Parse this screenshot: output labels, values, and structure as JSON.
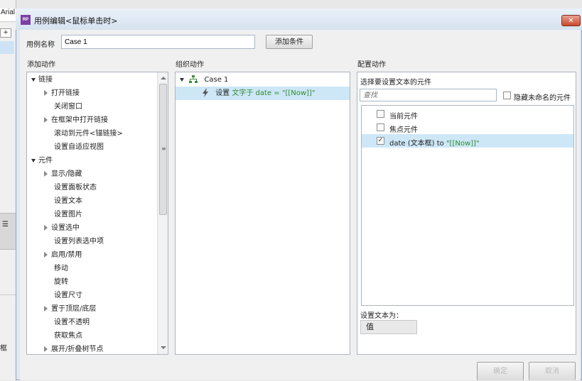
{
  "background_app": {
    "font_label": "Arial",
    "side_text": "框"
  },
  "dialog": {
    "title": "用例编辑<鼠标单击时>",
    "case_name_label": "用例名称",
    "case_name_value": "Case 1",
    "add_condition_label": "添加条件"
  },
  "add_action": {
    "header": "添加动作",
    "groups": [
      {
        "label": "链接",
        "items": [
          {
            "label": "打开链接",
            "expandable": true
          },
          {
            "label": "关闭窗口",
            "expandable": false
          },
          {
            "label": "在框架中打开链接",
            "expandable": true
          },
          {
            "label": "滚动到元件<锚链接>",
            "expandable": false
          },
          {
            "label": "设置自适应视图",
            "expandable": false
          }
        ]
      },
      {
        "label": "元件",
        "items": [
          {
            "label": "显示/隐藏",
            "expandable": true
          },
          {
            "label": "设置面板状态",
            "expandable": false
          },
          {
            "label": "设置文本",
            "expandable": false
          },
          {
            "label": "设置图片",
            "expandable": false
          },
          {
            "label": "设置选中",
            "expandable": true
          },
          {
            "label": "设置列表选中项",
            "expandable": false
          },
          {
            "label": "启用/禁用",
            "expandable": true
          },
          {
            "label": "移动",
            "expandable": false
          },
          {
            "label": "旋转",
            "expandable": false
          },
          {
            "label": "设置尺寸",
            "expandable": false
          },
          {
            "label": "置于顶层/底层",
            "expandable": true
          },
          {
            "label": "设置不透明",
            "expandable": false
          },
          {
            "label": "获取焦点",
            "expandable": false
          },
          {
            "label": "展开/折叠树节点",
            "expandable": true
          }
        ]
      }
    ]
  },
  "organize_action": {
    "header": "组织动作",
    "case_label": "Case 1",
    "action_prefix": "设置",
    "action_detail": "文字于 date = \"[[Now]]\""
  },
  "configure_action": {
    "header": "配置动作",
    "select_label": "选择要设置文本的元件",
    "search_placeholder": "查找",
    "hide_unnamed_label": "隐藏未命名的元件",
    "widgets": [
      {
        "label_main": "当前元件",
        "label_green": "",
        "checked": false
      },
      {
        "label_main": "焦点元件",
        "label_green": "",
        "checked": false
      },
      {
        "label_main": "date (文本框) to",
        "label_green": "\"[[Now]]\"",
        "checked": true
      }
    ],
    "set_text_label": "设置文本为：",
    "value_type": "值"
  },
  "footer": {
    "ok_label": "确定",
    "cancel_label": "取消"
  }
}
